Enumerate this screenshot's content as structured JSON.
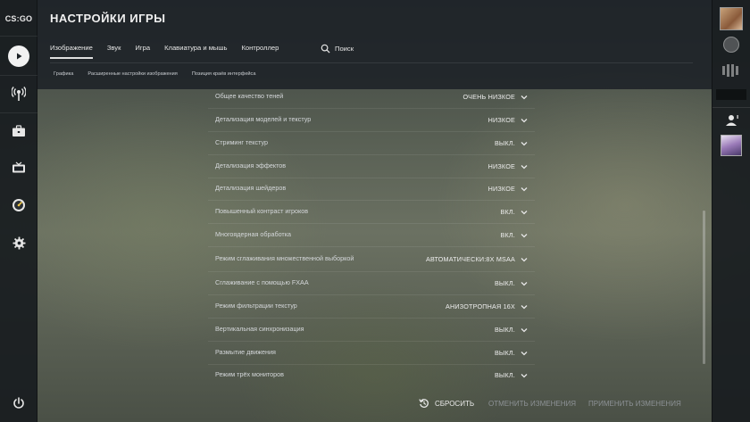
{
  "app": {
    "logo_text": "CS:GO"
  },
  "left_nav": {
    "items": [
      {
        "name": "play",
        "icon": "play-icon"
      },
      {
        "name": "watch",
        "icon": "antenna-icon"
      },
      {
        "name": "inventory",
        "icon": "briefcase-icon"
      },
      {
        "name": "tv",
        "icon": "tv-icon"
      },
      {
        "name": "stats",
        "icon": "dial-icon"
      },
      {
        "name": "settings",
        "icon": "gear-icon"
      }
    ],
    "power_icon": "power-icon"
  },
  "header": {
    "title": "НАСТРОЙКИ ИГРЫ",
    "tabs": [
      {
        "label": "Изображение",
        "active": true
      },
      {
        "label": "Звук",
        "active": false
      },
      {
        "label": "Игра",
        "active": false
      },
      {
        "label": "Клавиатура и мышь",
        "active": false
      },
      {
        "label": "Контроллер",
        "active": false
      }
    ],
    "search_label": "Поиск",
    "subtabs": [
      {
        "label": "Графика"
      },
      {
        "label": "Расширенные настройки изображения"
      },
      {
        "label": "Позиция краёв интерфейса"
      }
    ]
  },
  "settings": [
    {
      "label": "Общее качество теней",
      "value": "ОЧЕНЬ НИЗКОЕ"
    },
    {
      "label": "Детализация моделей и текстур",
      "value": "НИЗКОЕ"
    },
    {
      "label": "Стриминг текстур",
      "value": "ВЫКЛ."
    },
    {
      "label": "Детализация эффектов",
      "value": "НИЗКОЕ"
    },
    {
      "label": "Детализация шейдеров",
      "value": "НИЗКОЕ"
    },
    {
      "label": "Повышенный контраст игроков",
      "value": "ВКЛ."
    },
    {
      "label": "Многоядерная обработка",
      "value": "ВКЛ."
    },
    {
      "label": "Режим сглаживания множественной выборкой",
      "value": "АВТОМАТИЧЕСКИ:8X MSAA"
    },
    {
      "label": "Сглаживание с помощью FXAA",
      "value": "ВЫКЛ."
    },
    {
      "label": "Режим фильтрации текстур",
      "value": "АНИЗОТРОПНАЯ 16X"
    },
    {
      "label": "Вертикальная синхронизация",
      "value": "ВЫКЛ."
    },
    {
      "label": "Размытие движения",
      "value": "ВЫКЛ."
    },
    {
      "label": "Режим трёх мониторов",
      "value": "ВЫКЛ."
    }
  ],
  "footer": {
    "reset_label": "СБРОСИТЬ",
    "cancel_label": "ОТМЕНИТЬ ИЗМЕНЕНИЯ",
    "apply_label": "ПРИМЕНИТЬ ИЗМЕНЕНИЯ"
  },
  "colors": {
    "panel_bg": "#1c2126",
    "text": "#d8dadc",
    "disabled_text": "#8d9296"
  }
}
